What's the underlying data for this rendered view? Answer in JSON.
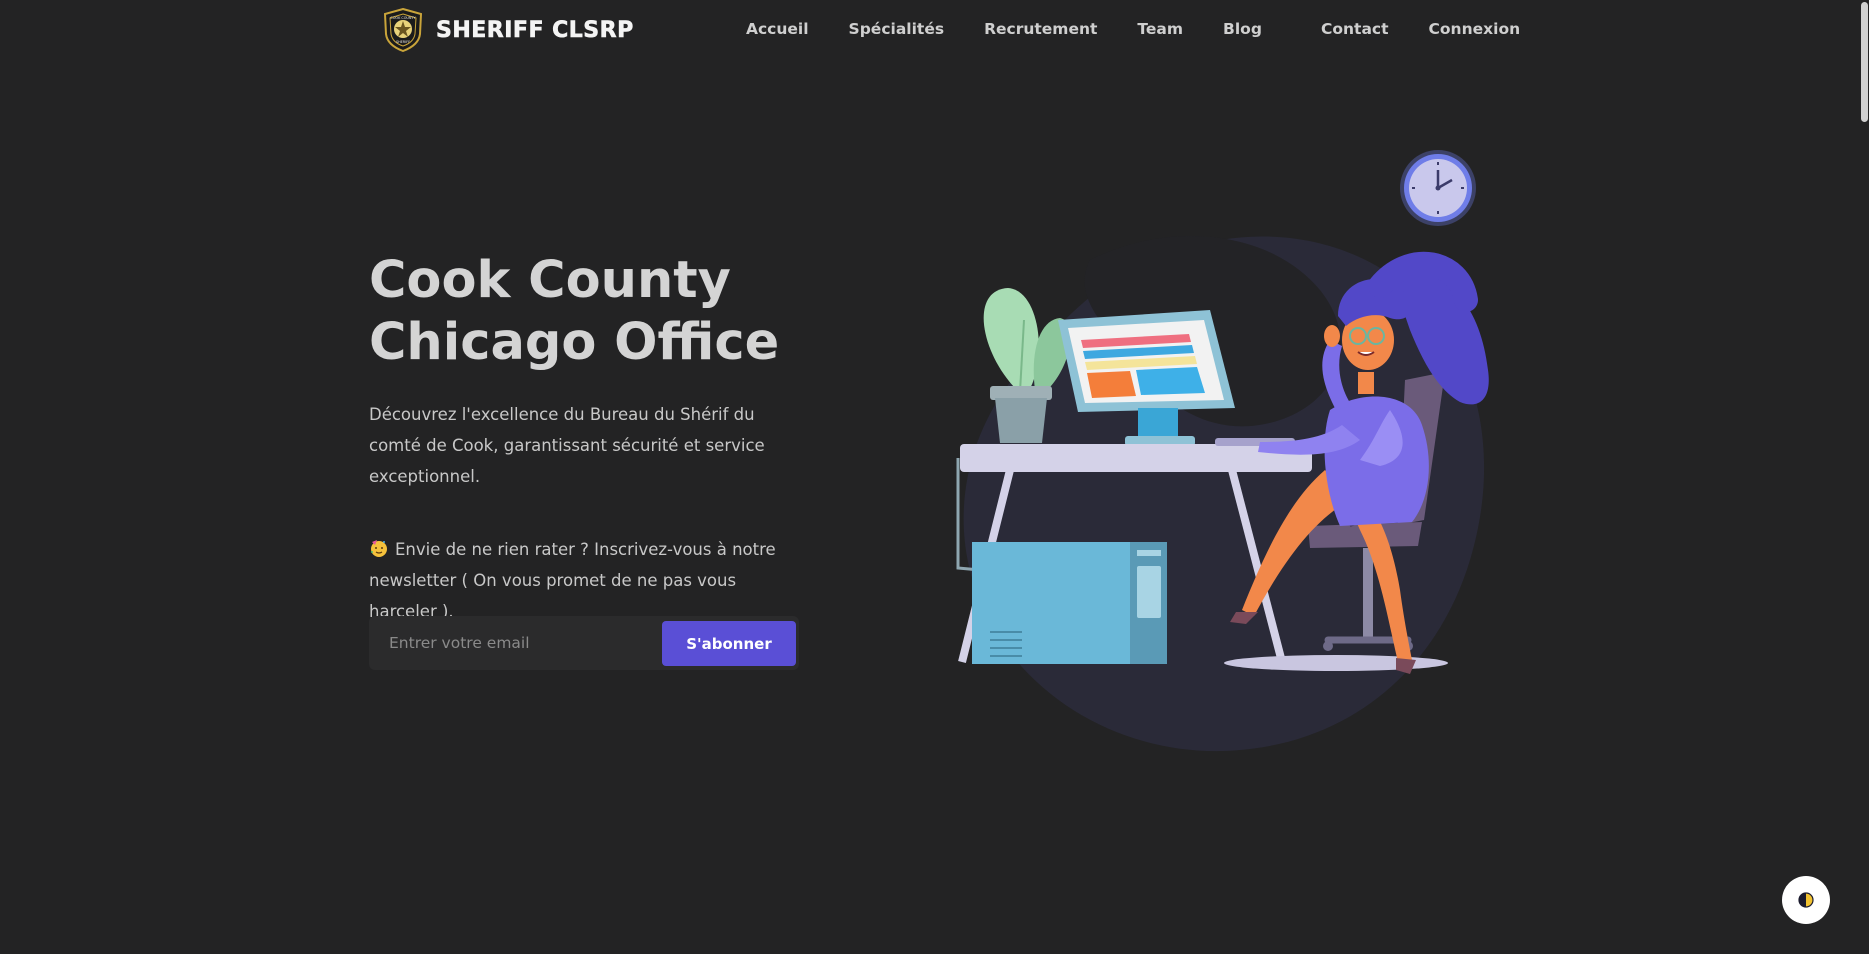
{
  "brand": {
    "name": "SHERIFF CLSRP",
    "logo_icon": "sheriff-badge-icon",
    "badge_text_top": "COOK COUNTY",
    "badge_text_bottom": "SHERIFF"
  },
  "nav": {
    "items": [
      {
        "label": "Accueil"
      },
      {
        "label": "Spécialités"
      },
      {
        "label": "Recrutement"
      },
      {
        "label": "Team"
      },
      {
        "label": "Blog"
      }
    ],
    "right": [
      {
        "label": "Contact"
      },
      {
        "label": "Connexion"
      }
    ]
  },
  "hero": {
    "title_line1": "Cook County",
    "title_line2": "Chicago Office",
    "description": "Découvrez l'excellence du Bureau du Shérif du comté de Cook, garantissant sécurité et service exceptionnel.",
    "newsletter_text": "Envie de ne rien rater ? Inscrivez-vous à notre newsletter ( On vous promet de ne pas vous harceler ).",
    "newsletter_icon": "party-face-emoji-icon"
  },
  "subscribe": {
    "placeholder": "Entrer votre email",
    "button_label": "S'abonner"
  },
  "illustration": {
    "icon": "woman-at-desk-illustration"
  },
  "theme_toggle": {
    "icon": "half-circle-theme-icon"
  },
  "colors": {
    "background": "#232324",
    "accent": "#5a4fd6",
    "text": "#c8c8c8"
  }
}
